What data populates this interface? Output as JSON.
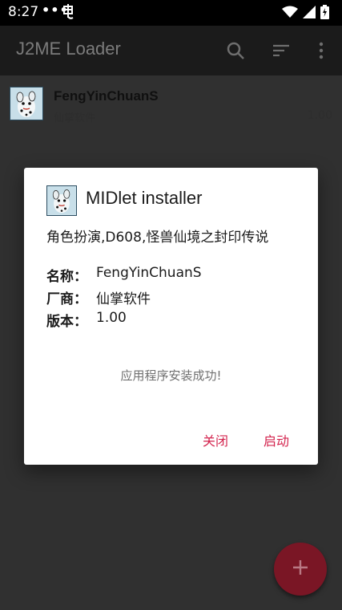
{
  "status_bar": {
    "time": "8:27",
    "dots": "•••",
    "icons": [
      "notification-app-icon",
      "wifi-icon",
      "signal-icon",
      "battery-charging-icon"
    ]
  },
  "app_bar": {
    "title": "J2ME Loader",
    "icons": [
      "search-icon",
      "sort-icon",
      "more-vert-icon"
    ]
  },
  "list": {
    "items": [
      {
        "title": "FengYinChuanS",
        "vendor": "仙掌软件",
        "version": "1.00",
        "icon": "dalmatian-app-icon"
      }
    ]
  },
  "fab": {
    "label": "+",
    "icon": "add-icon",
    "color": "#7a1625"
  },
  "dialog": {
    "title": "MIDlet installer",
    "icon": "dalmatian-app-icon",
    "description": "角色扮演,D608,怪兽仙境之封印传说",
    "fields": [
      {
        "label": "名称：",
        "value": "FengYinChuanS"
      },
      {
        "label": "厂商：",
        "value": "仙掌软件"
      },
      {
        "label": "版本：",
        "value": "1.00"
      }
    ],
    "message": "应用程序安装成功!",
    "buttons": {
      "close": "关闭",
      "launch": "启动"
    },
    "accent_color": "#d3244e"
  }
}
